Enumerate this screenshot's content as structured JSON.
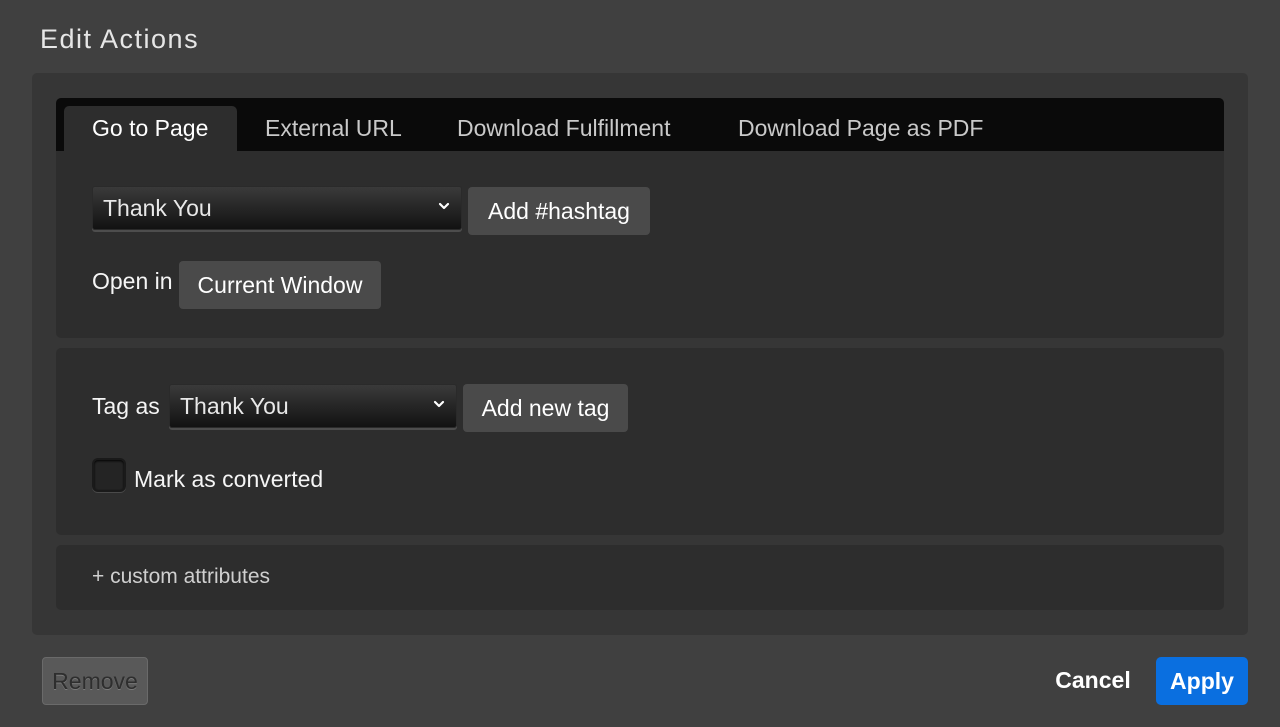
{
  "dialog": {
    "title": "Edit Actions"
  },
  "tabs": [
    {
      "label": "Go to Page",
      "active": true
    },
    {
      "label": "External URL",
      "active": false
    },
    {
      "label": "Download Fulfillment",
      "active": false
    },
    {
      "label": "Download Page as PDF",
      "active": false
    }
  ],
  "goto": {
    "page_select_value": "Thank You",
    "add_hashtag_label": "Add #hashtag",
    "open_in_label": "Open in",
    "open_in_value": "Current Window"
  },
  "tagging": {
    "tag_as_label": "Tag as",
    "tag_select_value": "Thank You",
    "add_new_tag_label": "Add new tag",
    "mark_converted_label": "Mark as converted",
    "mark_converted_checked": false
  },
  "custom_attributes_label": "+ custom attributes",
  "footer": {
    "remove_label": "Remove",
    "cancel_label": "Cancel",
    "apply_label": "Apply"
  },
  "icons": {
    "select_chevron": "chevron-down-icon",
    "checkbox": "checkbox-icon"
  },
  "colors": {
    "apply_accent": "#0a6fe0",
    "background": "#404040"
  }
}
